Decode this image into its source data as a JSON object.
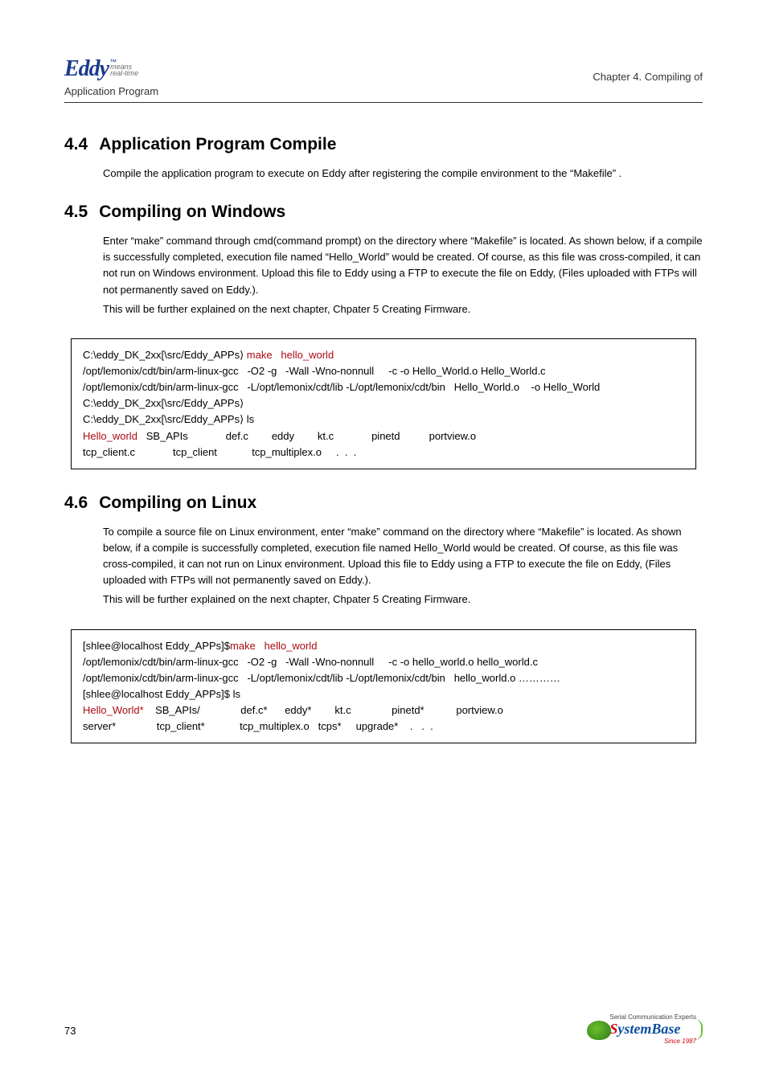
{
  "header": {
    "logo": "Eddy",
    "logo_tm": "™",
    "logo_means": "means",
    "logo_rt": "real-time",
    "subtitle": "Application Program",
    "chapter": "Chapter 4. Compiling of"
  },
  "sections": {
    "s44": {
      "num": "4.4",
      "title": "Application Program Compile",
      "body": "Compile the application program to execute on Eddy after registering the compile environment to the “Makefile” ."
    },
    "s45": {
      "num": "4.5",
      "title": "Compiling on Windows",
      "body": "Enter   “make”   command through cmd(command prompt) on the directory where   “Makefile”   is located.    As shown below, if a compile is successfully completed, execution file named   “Hello_World”   would be created.  Of course, as this file was cross-compiled, it can not run on Windows environment.  Upload this file to Eddy using a FTP to execute the file on Eddy, (Files uploaded with FTPs will not permanently saved on Eddy.).",
      "body2": "This will be further explained on the next chapter, Chpater 5 Creating Firmware.",
      "code": {
        "l1a": "C:\\eddy_DK_2xx[\\src/Eddy_APPs⟩ ",
        "l1b": "make   hello_world",
        "l2": "/opt/lemonix/cdt/bin/arm-linux-gcc   -O2 -g   -Wall -Wno-nonnull     -c -o Hello_World.o Hello_World.c",
        "l3": "/opt/lemonix/cdt/bin/arm-linux-gcc   -L/opt/lemonix/cdt/lib -L/opt/lemonix/cdt/bin   Hello_World.o    -o Hello_World",
        "l4": "C:\\eddy_DK_2xx[\\src/Eddy_APPs⟩",
        "l5": "C:\\eddy_DK_2xx[\\src/Eddy_APPs⟩ ls",
        "l6a": "Hello_world",
        "l6b": "   SB_APIs             def.c        eddy        kt.c             pinetd          portview.o",
        "l7": "tcp_client.c             tcp_client            tcp_multiplex.o     .  .  ."
      }
    },
    "s46": {
      "num": "4.6",
      "title": "Compiling on Linux",
      "body": "To compile a source file on Linux environment, enter   “make”   command on the directory where   “Makefile”   is located.  As shown below, if a compile is successfully completed, execution file named Hello_World would be created.   Of course, as this file was cross-compiled, it can not run on Linux environment.   Upload this file to Eddy using a FTP to execute the file on Eddy, (Files uploaded with FTPs will not permanently saved on Eddy.).",
      "body2": "This will be further explained on the next chapter, Chpater 5 Creating Firmware.",
      "code": {
        "l1a": "[shlee@localhost Eddy_APPs]$",
        "l1b": "make   hello_world",
        "l2": "/opt/lemonix/cdt/bin/arm-linux-gcc   -O2 -g   -Wall -Wno-nonnull     -c -o hello_world.o hello_world.c",
        "l3": "/opt/lemonix/cdt/bin/arm-linux-gcc   -L/opt/lemonix/cdt/lib -L/opt/lemonix/cdt/bin   hello_world.o …………",
        "l4": "[shlee@localhost Eddy_APPs]$ ls",
        "l5a": "Hello_World*",
        "l5b": "    SB_APIs/              def.c*      eddy*        kt.c              pinetd*           portview.o",
        "l6": "server*              tcp_client*            tcp_multiplex.o   tcps*     upgrade*    .   .  ."
      }
    }
  },
  "footer": {
    "page": "73",
    "logo_top": "Serial Communication Experts",
    "logo_name_s": "S",
    "logo_name_rest": "ystemBase",
    "logo_since": "Since 1987"
  }
}
